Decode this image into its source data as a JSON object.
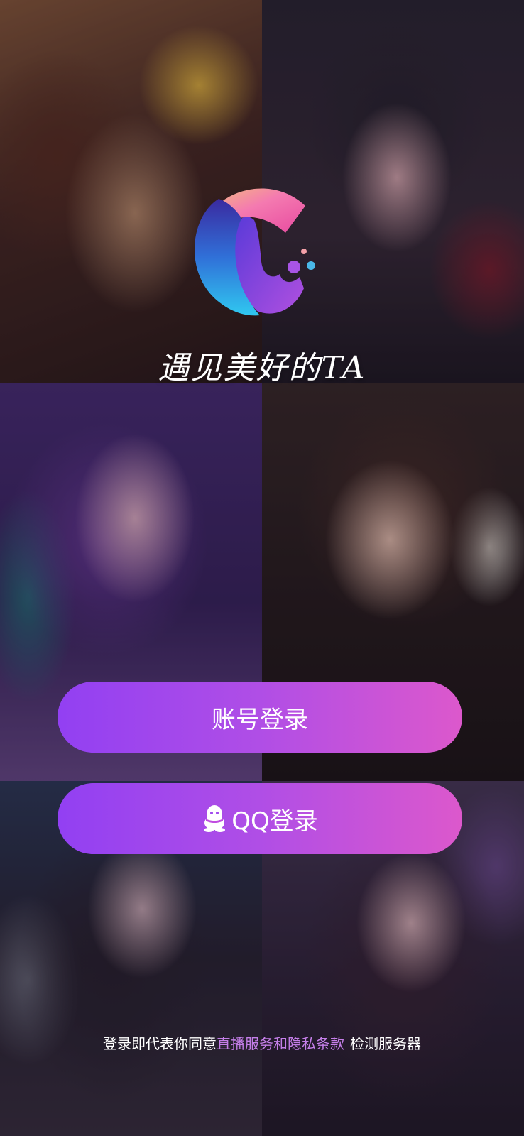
{
  "branding": {
    "slogan": "遇见美好的TA",
    "logo_icon": "c-logo-icon"
  },
  "buttons": {
    "account_login": "账号登录",
    "qq_login": "QQ登录",
    "qq_icon": "qq-penguin-icon"
  },
  "terms": {
    "prefix": "登录即代表你同意",
    "link": "直播服务和隐私条款",
    "check_server": "检测服务器"
  },
  "colors": {
    "button_gradient_start": "#9240f2",
    "button_gradient_end": "#dc58cc",
    "link": "#c47ee8"
  }
}
